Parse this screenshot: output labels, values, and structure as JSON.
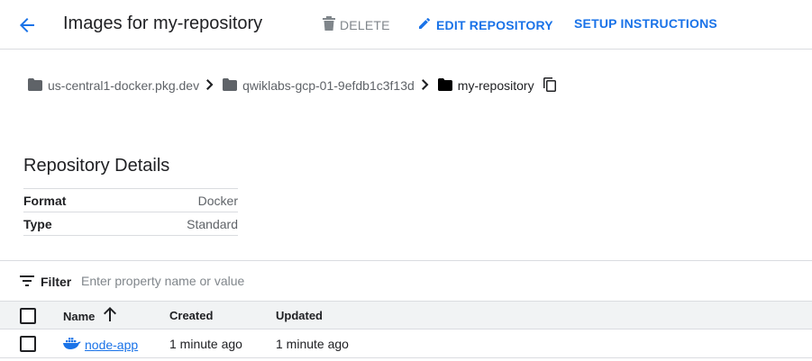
{
  "header": {
    "title": "Images for my-repository",
    "delete_label": "DELETE",
    "edit_label": "EDIT REPOSITORY",
    "setup_label": "SETUP INSTRUCTIONS"
  },
  "breadcrumb": {
    "items": [
      {
        "label": "us-central1-docker.pkg.dev",
        "icon": "folder-icon"
      },
      {
        "label": "qwiklabs-gcp-01-9efdb1c3f13d",
        "icon": "folder-icon"
      },
      {
        "label": "my-repository",
        "icon": "folder-icon"
      }
    ],
    "separator_icon": "chevron-right-icon",
    "copy_icon": "copy-icon"
  },
  "details": {
    "title": "Repository Details",
    "rows": [
      {
        "key": "Format",
        "value": "Docker"
      },
      {
        "key": "Type",
        "value": "Standard"
      }
    ]
  },
  "filter": {
    "label": "Filter",
    "placeholder": "Enter property name or value"
  },
  "table": {
    "columns": {
      "name": "Name",
      "created": "Created",
      "updated": "Updated"
    },
    "sort": {
      "column": "Name",
      "direction": "ascending"
    },
    "rows": [
      {
        "name": "node-app",
        "created": "1 minute ago",
        "updated": "1 minute ago",
        "icon": "docker-icon"
      }
    ]
  },
  "colors": {
    "accent": "#1a73e8",
    "text": "#202124",
    "muted": "#5f6368",
    "disabled": "#80868b",
    "divider": "#dadce0",
    "table_header_bg": "#f1f3f4"
  }
}
